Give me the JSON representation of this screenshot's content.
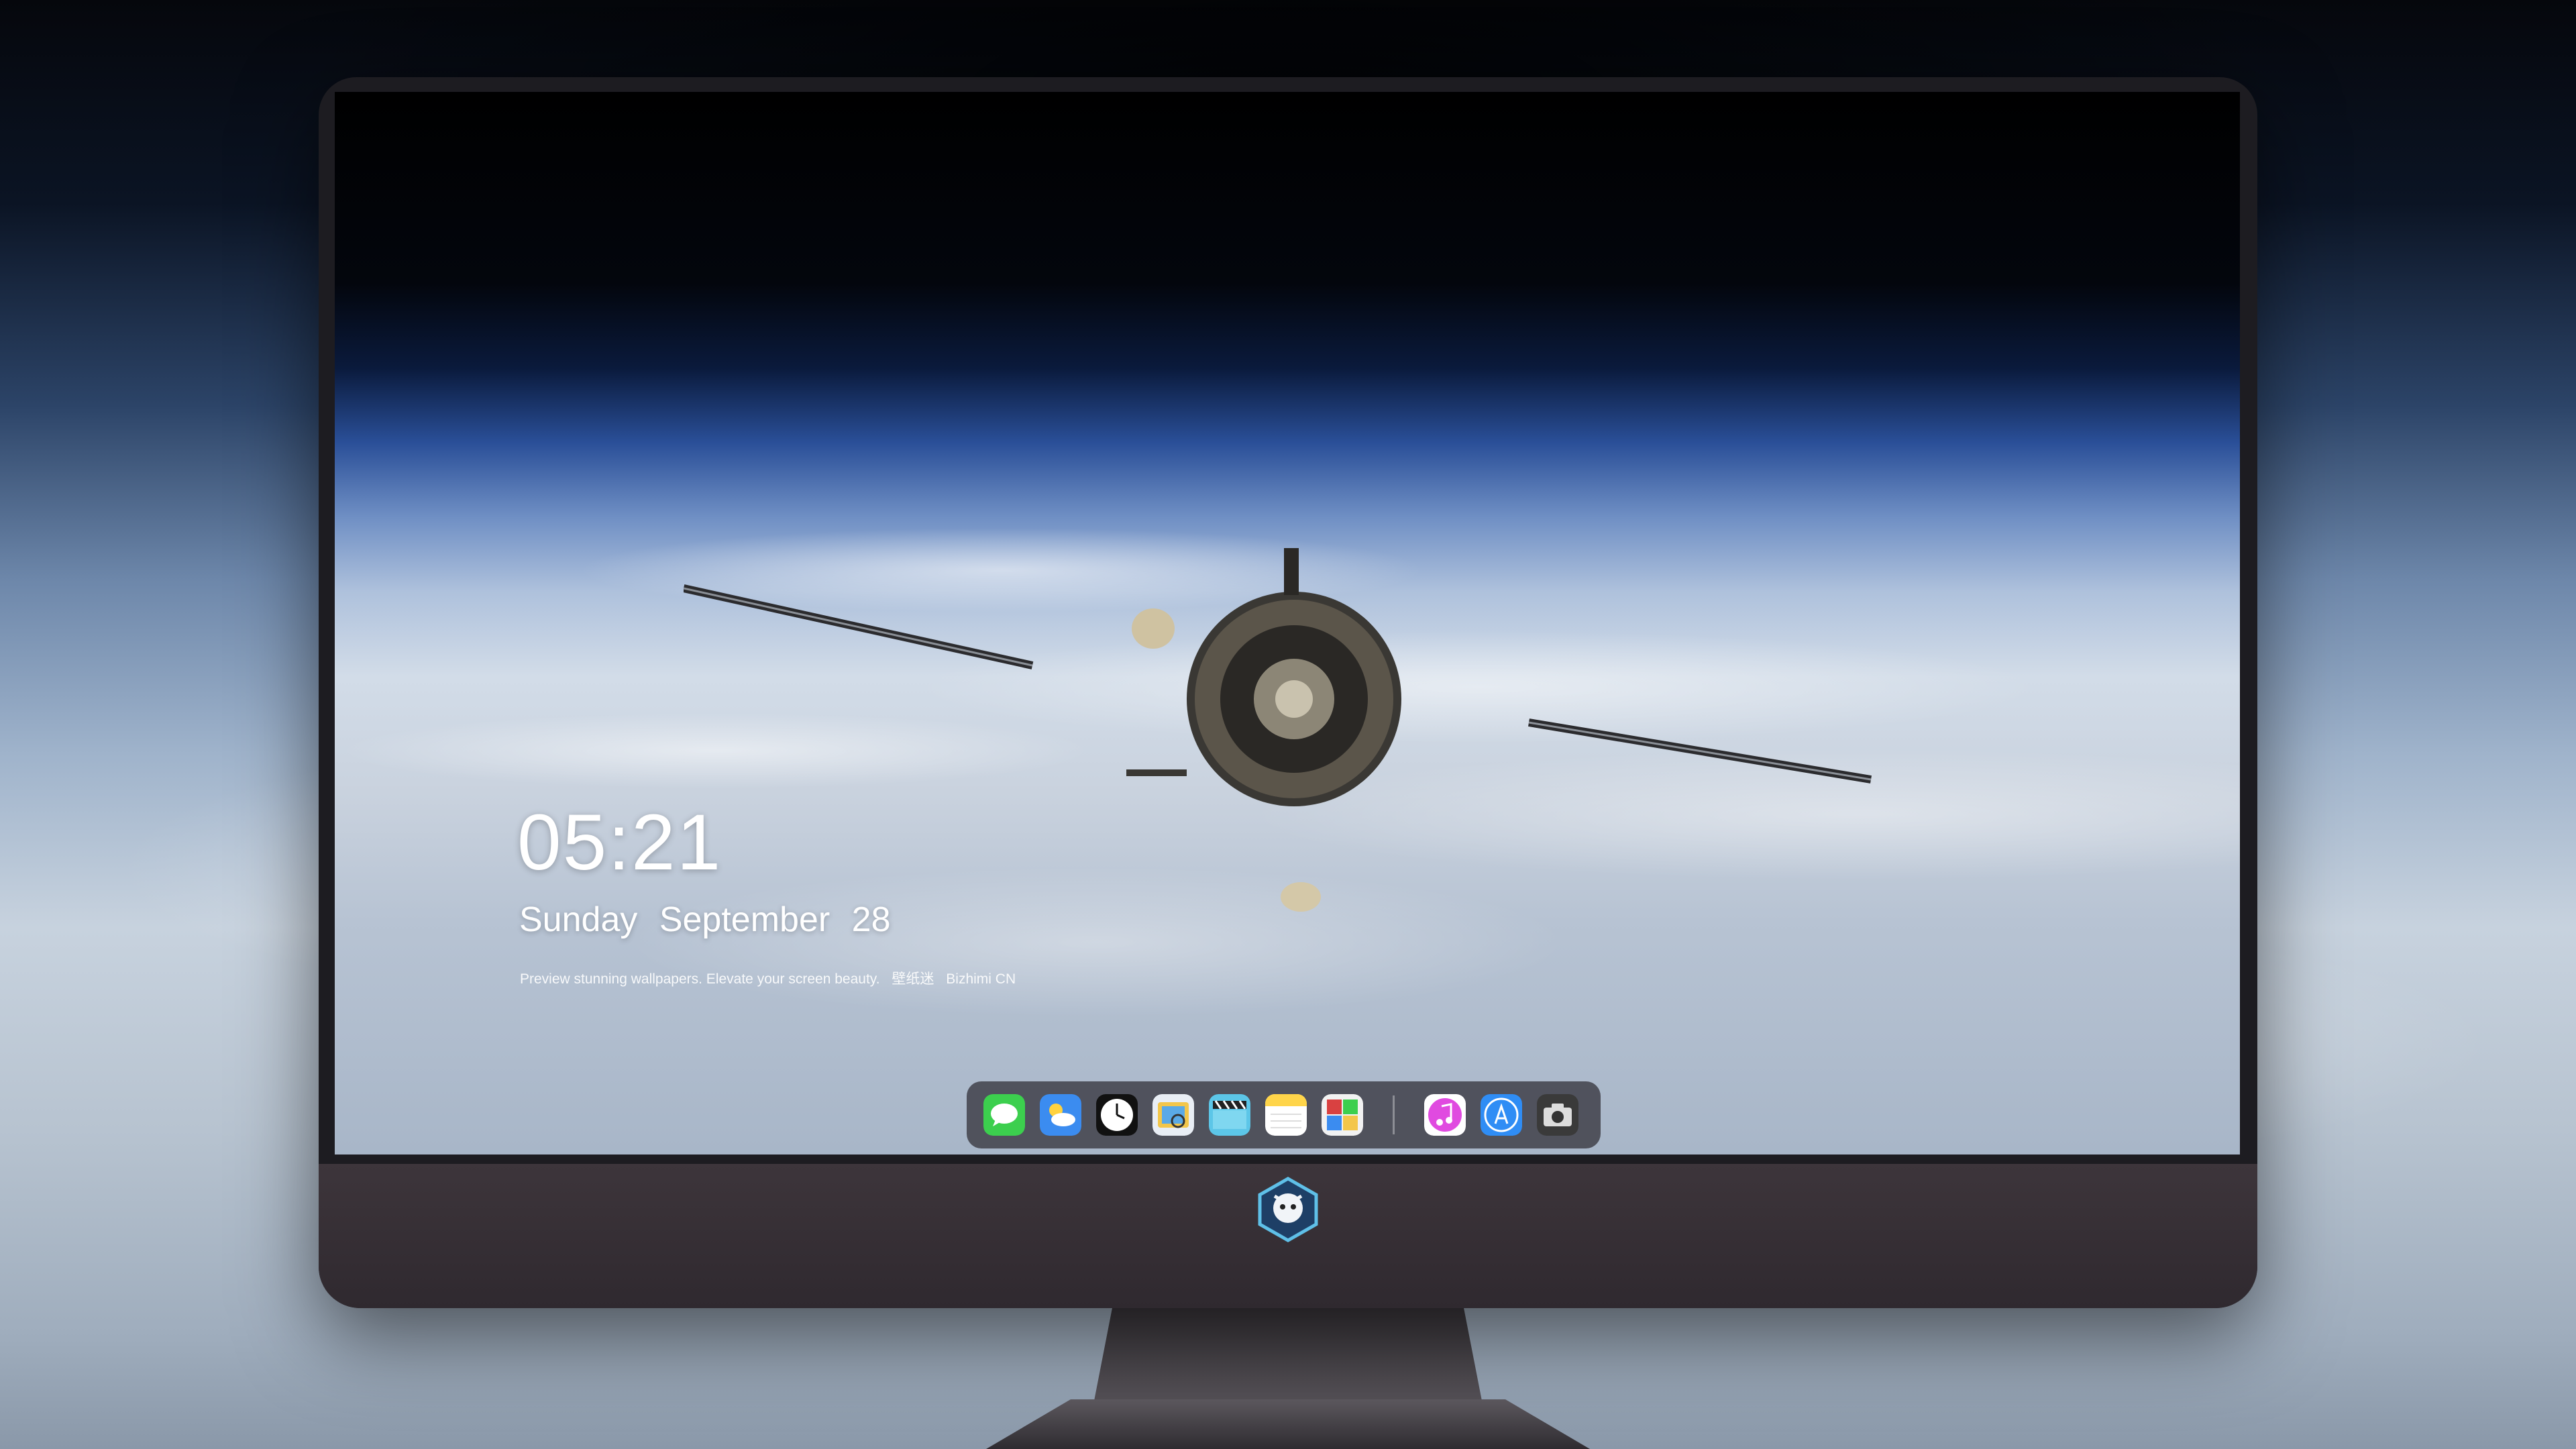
{
  "lock_screen": {
    "time": "05:21",
    "weekday": "Sunday",
    "month": "September",
    "day": "28",
    "caption_text": "Preview stunning wallpapers. Elevate your screen beauty.",
    "caption_brand_cn": "壁纸迷",
    "caption_brand": "Bizhimi CN"
  },
  "dock": {
    "apps": [
      {
        "name": "messages-icon",
        "color": "#3ccf4e"
      },
      {
        "name": "weather-icon",
        "color": "#3b8cf0"
      },
      {
        "name": "clock-icon",
        "color": "#111111"
      },
      {
        "name": "preview-icon",
        "color": "#f3c64a"
      },
      {
        "name": "clips-icon",
        "color": "#5cc6e8"
      },
      {
        "name": "notes-icon",
        "color": "#ffd54a"
      },
      {
        "name": "photo-booth-icon",
        "color": "#d94141"
      },
      {
        "name": "music-icon",
        "color": "#e04ae0"
      },
      {
        "name": "app-store-icon",
        "color": "#2f8df5"
      },
      {
        "name": "camera-icon",
        "color": "#3a3a3a"
      }
    ]
  },
  "colors": {
    "bezel": "#1d1c21",
    "chin": "#3d353b"
  }
}
